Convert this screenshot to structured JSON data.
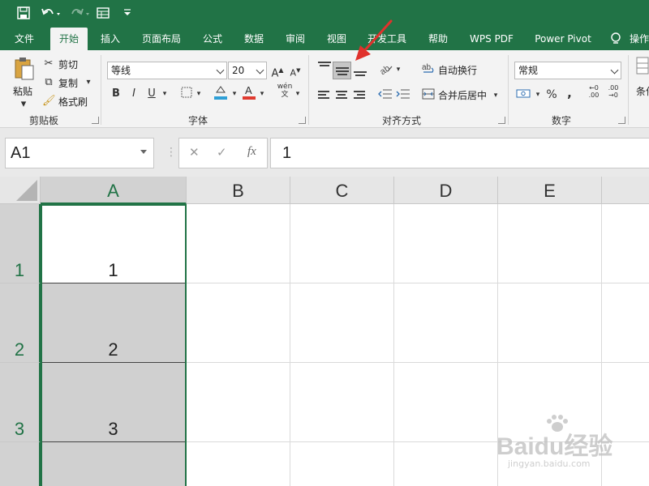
{
  "qat": {
    "save_icon": "save-icon",
    "undo_icon": "undo-icon",
    "redo_icon": "redo-icon",
    "form_icon": "form-icon",
    "customize_icon": "customize-icon"
  },
  "tabs": [
    {
      "label": "文件"
    },
    {
      "label": "开始"
    },
    {
      "label": "插入"
    },
    {
      "label": "页面布局"
    },
    {
      "label": "公式"
    },
    {
      "label": "数据"
    },
    {
      "label": "审阅"
    },
    {
      "label": "视图"
    },
    {
      "label": "开发工具"
    },
    {
      "label": "帮助"
    },
    {
      "label": "WPS PDF"
    },
    {
      "label": "Power Pivot"
    },
    {
      "label": "操作"
    }
  ],
  "ribbon": {
    "clipboard": {
      "label": "剪贴板",
      "paste": "粘贴",
      "cut": "剪切",
      "copy": "复制",
      "format_painter": "格式刷"
    },
    "font": {
      "label": "字体",
      "font_name": "等线",
      "font_size": "20",
      "bold": "B",
      "italic": "I",
      "underline": "U",
      "phonetic": "wén"
    },
    "alignment": {
      "label": "对齐方式",
      "wrap_text": "自动换行",
      "merge_center": "合并后居中"
    },
    "number": {
      "label": "数字",
      "format": "常规",
      "percent": "%",
      "comma": ","
    },
    "styles": {
      "conditional": "条件"
    }
  },
  "formula_bar": {
    "name_box": "A1",
    "cancel": "✕",
    "enter": "✓",
    "fx": "fx",
    "value": "1"
  },
  "grid": {
    "columns": [
      "A",
      "B",
      "C",
      "D",
      "E"
    ],
    "rows": [
      {
        "num": "1",
        "a": "1"
      },
      {
        "num": "2",
        "a": "2"
      },
      {
        "num": "3",
        "a": "3"
      },
      {
        "num": "",
        "a": ""
      }
    ]
  },
  "colors": {
    "accent": "#217346",
    "selection": "#d0d0d0",
    "arrow": "#e0322c"
  },
  "watermark": {
    "brand": "Baidu经验",
    "url": "jingyan.baidu.com"
  }
}
